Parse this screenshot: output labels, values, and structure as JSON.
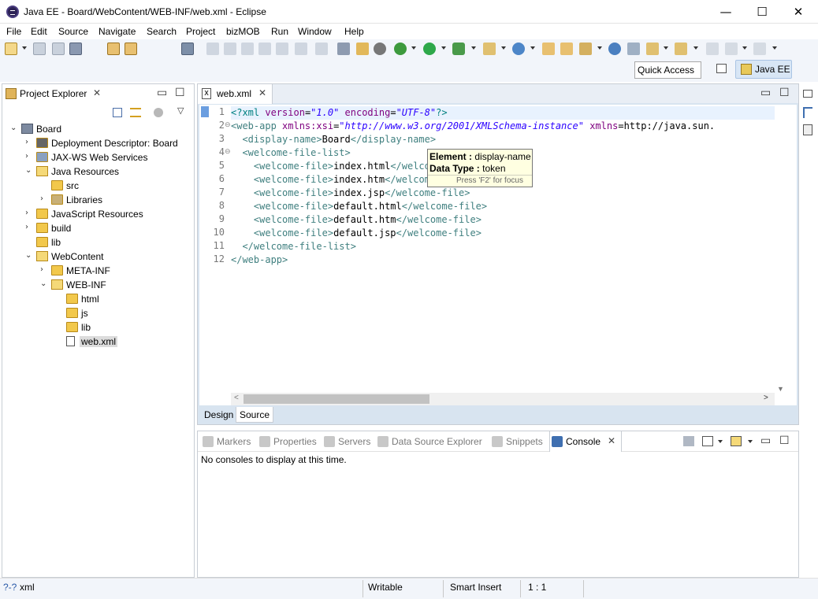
{
  "window": {
    "title": "Java EE - Board/WebContent/WEB-INF/web.xml - Eclipse",
    "minimize": "—",
    "maximize": "☐",
    "close": "✕"
  },
  "menu": [
    "File",
    "Edit",
    "Source",
    "Navigate",
    "Search",
    "Project",
    "bizMOB",
    "Run",
    "Window",
    "Help"
  ],
  "toolbar": {
    "quick_access": "Quick Access",
    "perspective": "Java EE"
  },
  "project_explorer": {
    "title": "Project Explorer",
    "tree": [
      {
        "label": "Board",
        "depth": 0,
        "expanded": true
      },
      {
        "label": "Deployment Descriptor: Board",
        "depth": 1,
        "expanded": false
      },
      {
        "label": "JAX-WS Web Services",
        "depth": 1,
        "expanded": false
      },
      {
        "label": "Java Resources",
        "depth": 1,
        "expanded": true
      },
      {
        "label": "src",
        "depth": 2,
        "expanded": null
      },
      {
        "label": "Libraries",
        "depth": 2,
        "expanded": false
      },
      {
        "label": "JavaScript Resources",
        "depth": 1,
        "expanded": false
      },
      {
        "label": "build",
        "depth": 1,
        "expanded": false
      },
      {
        "label": "lib",
        "depth": 1,
        "expanded": null
      },
      {
        "label": "WebContent",
        "depth": 1,
        "expanded": true
      },
      {
        "label": "META-INF",
        "depth": 2,
        "expanded": false
      },
      {
        "label": "WEB-INF",
        "depth": 2,
        "expanded": true
      },
      {
        "label": "html",
        "depth": 3,
        "expanded": null
      },
      {
        "label": "js",
        "depth": 3,
        "expanded": null
      },
      {
        "label": "lib",
        "depth": 3,
        "expanded": null
      },
      {
        "label": "web.xml",
        "depth": 3,
        "expanded": null,
        "selected": true
      }
    ]
  },
  "editor": {
    "tab": "web.xml",
    "line_numbers": [
      "1",
      "2",
      "3",
      "4",
      "5",
      "6",
      "7",
      "8",
      "9",
      "10",
      "11",
      "12"
    ],
    "lines": [
      "<?xml version=\"1.0\" encoding=\"UTF-8\"?>",
      "<web-app xmlns:xsi=\"http://www.w3.org/2001/XMLSchema-instance\" xmlns=\"http://java.sun.",
      "  <display-name>Board</display-name>",
      "  <welcome-file-list>",
      "    <welcome-file>index.html</welcome-file>",
      "    <welcome-file>index.htm</welcome-file>",
      "    <welcome-file>index.jsp</welcome-file>",
      "    <welcome-file>default.html</welcome-file>",
      "    <welcome-file>default.htm</welcome-file>",
      "    <welcome-file>default.jsp</welcome-file>",
      "  </welcome-file-list>",
      "</web-app>"
    ],
    "modes": [
      "Design",
      "Source"
    ],
    "active_mode": "Source",
    "tooltip": {
      "element_label": "Element :",
      "element_value": "display-name",
      "type_label": "Data Type :",
      "type_value": "token",
      "hint": "Press 'F2' for focus"
    }
  },
  "bottom_panel": {
    "tabs": [
      "Markers",
      "Properties",
      "Servers",
      "Data Source Explorer",
      "Snippets",
      "Console"
    ],
    "active_tab": "Console",
    "message": "No consoles to display at this time."
  },
  "statusbar": {
    "content_type": "xml",
    "writable": "Writable",
    "insert_mode": "Smart Insert",
    "position": "1 : 1"
  },
  "colors": {
    "xml_tag": "#3f7f7f",
    "xml_attr": "#7f007f",
    "xml_value": "#2a00ff",
    "selection_accent": "#6b9ee0"
  }
}
